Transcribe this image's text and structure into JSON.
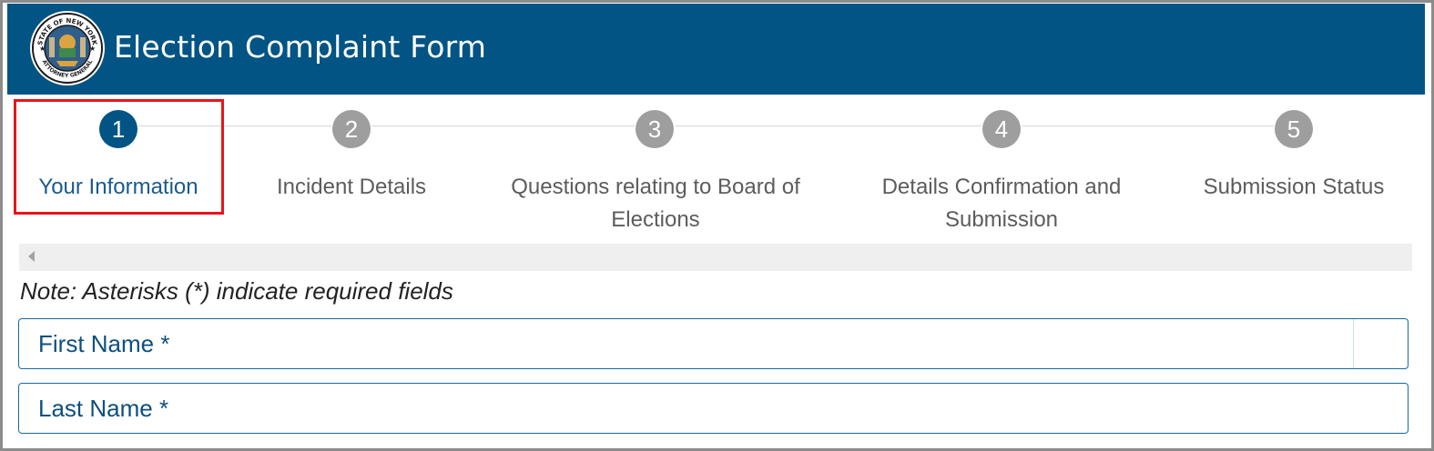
{
  "header": {
    "title": "Election Complaint Form",
    "logo_icon": "new-york-attorney-general-seal-icon",
    "seal_text_top": "STATE OF NEW YORK",
    "seal_text_bottom": "ATTORNEY GENERAL",
    "background_color": "#015483"
  },
  "stepper": {
    "active_color": "#015483",
    "inactive_color": "#9e9e9e",
    "highlight_color": "#e8141b",
    "steps": [
      {
        "number": "1",
        "label": "Your Information",
        "state": "active"
      },
      {
        "number": "2",
        "label": "Incident Details",
        "state": "inactive"
      },
      {
        "number": "3",
        "label_line1": "Questions relating to Board of",
        "label_line2": "Elections",
        "state": "inactive"
      },
      {
        "number": "4",
        "label_line1": "Details Confirmation and",
        "label_line2": "Submission",
        "state": "inactive"
      },
      {
        "number": "5",
        "label": "Submission Status",
        "state": "inactive"
      }
    ]
  },
  "scrollbar": {
    "arrow_icon": "scroll-left-arrow-icon"
  },
  "form": {
    "note": "Note: Asterisks (*) indicate required fields",
    "first_name_label": "First Name *",
    "first_name_value": "",
    "last_name_label": "Last Name *",
    "last_name_value": ""
  }
}
